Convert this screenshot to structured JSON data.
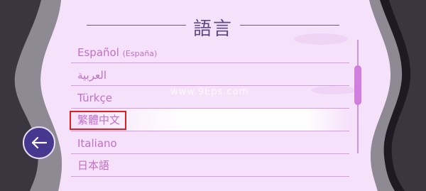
{
  "header": {
    "title": "語言"
  },
  "languages": [
    {
      "label": "Español",
      "sub": "(España)"
    },
    {
      "label": "العربية",
      "sub": ""
    },
    {
      "label": "Türkçe",
      "sub": ""
    },
    {
      "label": "繁體中文",
      "sub": ""
    },
    {
      "label": "Italiano",
      "sub": ""
    },
    {
      "label": "日本語",
      "sub": ""
    }
  ],
  "selected_index": 3,
  "back_button": {
    "icon": "arrow-left-icon"
  },
  "watermark": "www.9Eps.com",
  "colors": {
    "panel": "#f6e1fb",
    "title": "#5a4a86",
    "item_text": "#c070c8",
    "divider": "#d79be3",
    "scroll_thumb": "#d27ee0",
    "back_button": "#46388f",
    "highlight_border": "#e02020"
  }
}
